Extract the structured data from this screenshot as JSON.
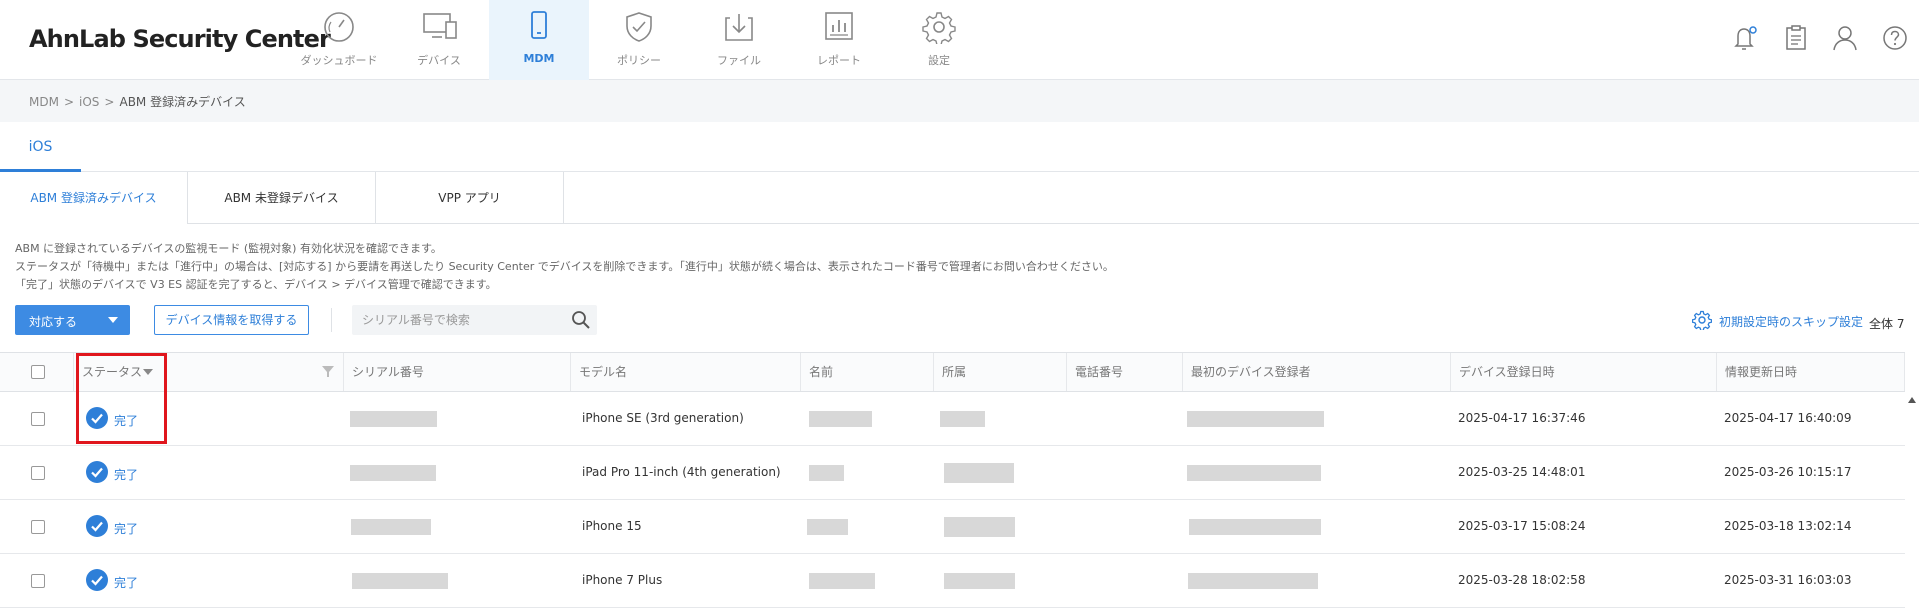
{
  "app": {
    "title": "AhnLab Security Center"
  },
  "nav": [
    {
      "label": "ダッシュボード",
      "icon": "dashboard-icon",
      "active": false
    },
    {
      "label": "デバイス",
      "icon": "devices-icon",
      "active": false
    },
    {
      "label": "MDM",
      "icon": "mobile-icon",
      "active": true
    },
    {
      "label": "ポリシー",
      "icon": "shield-icon",
      "active": false
    },
    {
      "label": "ファイル",
      "icon": "file-download-icon",
      "active": false
    },
    {
      "label": "レポート",
      "icon": "report-icon",
      "active": false
    },
    {
      "label": "設定",
      "icon": "gear-icon",
      "active": false
    }
  ],
  "header_icons": [
    "notification-bell-icon",
    "clipboard-icon",
    "user-icon",
    "help-icon"
  ],
  "breadcrumb": {
    "items": [
      "MDM",
      "iOS",
      "ABM 登録済みデバイス"
    ],
    "sep": ">"
  },
  "platform_tab": {
    "label": "iOS"
  },
  "subtabs": [
    {
      "label": "ABM 登録済みデバイス",
      "active": true
    },
    {
      "label": "ABM 未登録デバイス",
      "active": false
    },
    {
      "label": "VPP アプリ",
      "active": false
    }
  ],
  "info": [
    "ABM に登録されているデバイスの監視モード (監視対象) 有効化状況を確認できます。",
    "ステータスが「待機中」または「進行中」の場合は、[対応する] から要請を再送したり Security Center でデバイスを削除できます。「進行中」状態が続く場合は、表示されたコード番号で管理者にお問い合わせください。",
    "「完了」状態のデバイスで V3 ES 認証を完了すると、デバイス > デバイス管理で確認できます。"
  ],
  "toolbar": {
    "action_label": "対応する",
    "fetch_label": "デバイス情報を取得する",
    "search_placeholder": "シリアル番号で検索",
    "skip_label": "初期設定時のスキップ設定",
    "total_label": "全体 7"
  },
  "table": {
    "columns": [
      "ステータス",
      "シリアル番号",
      "モデル名",
      "名前",
      "所属",
      "電話番号",
      "最初のデバイス登録者",
      "デバイス登録日時",
      "情報更新日時"
    ],
    "rows": [
      {
        "status": "完了",
        "model": "iPhone SE (3rd generation)",
        "registered": "2025-04-17 16:37:46",
        "updated": "2025-04-17 16:40:09"
      },
      {
        "status": "完了",
        "model": "iPad Pro 11-inch (4th generation)",
        "registered": "2025-03-25 14:48:01",
        "updated": "2025-03-26 10:15:17"
      },
      {
        "status": "完了",
        "model": "iPhone 15",
        "registered": "2025-03-17 15:08:24",
        "updated": "2025-03-18 13:02:14"
      },
      {
        "status": "完了",
        "model": "iPhone 7 Plus",
        "registered": "2025-03-28 18:02:58",
        "updated": "2025-03-31 16:03:03"
      }
    ]
  },
  "colors": {
    "accent": "#2e7fd8",
    "primary_button": "#3d8be3",
    "highlight": "#e0161d"
  }
}
